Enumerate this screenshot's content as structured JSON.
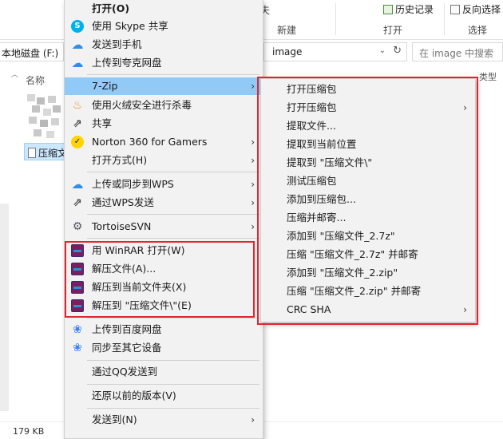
{
  "ribbon": {
    "history_label": "历史记录",
    "reverse_select_label": "反向选择",
    "new_group": "新建",
    "open_group": "打开",
    "select_group": "选择",
    "partial_left_glyph": "夫"
  },
  "address": {
    "left_text": "本地磁盘 (F:)",
    "current_folder": "image",
    "search_placeholder": "在 image 中搜索"
  },
  "filelist": {
    "column_name": "名称",
    "column_right": "类型",
    "selected_file": "压缩文"
  },
  "status": {
    "size_text": "179 KB"
  },
  "main_menu": {
    "items": [
      {
        "label": "打开(O)"
      },
      {
        "label": "使用 Skype 共享"
      },
      {
        "label": "发送到手机"
      },
      {
        "label": "上传到夸克网盘"
      },
      {
        "label": "7-Zip"
      },
      {
        "label": "使用火绒安全进行杀毒"
      },
      {
        "label": "共享"
      },
      {
        "label": "Norton 360 for Gamers"
      },
      {
        "label": "打开方式(H)"
      },
      {
        "label": "上传或同步到WPS"
      },
      {
        "label": "通过WPS发送"
      },
      {
        "label": "TortoiseSVN"
      },
      {
        "label": "用 WinRAR 打开(W)"
      },
      {
        "label": "解压文件(A)..."
      },
      {
        "label": "解压到当前文件夹(X)"
      },
      {
        "label": "解压到 \"压缩文件\\\"(E)"
      },
      {
        "label": "上传到百度网盘"
      },
      {
        "label": "同步至其它设备"
      },
      {
        "label": "通过QQ发送到"
      },
      {
        "label": "还原以前的版本(V)"
      },
      {
        "label": "发送到(N)"
      }
    ]
  },
  "sub_menu": {
    "items": [
      {
        "label": "打开压缩包"
      },
      {
        "label": "打开压缩包"
      },
      {
        "label": "提取文件..."
      },
      {
        "label": "提取到当前位置"
      },
      {
        "label": "提取到 \"压缩文件\\\""
      },
      {
        "label": "测试压缩包"
      },
      {
        "label": "添加到压缩包..."
      },
      {
        "label": "压缩并邮寄..."
      },
      {
        "label": "添加到 \"压缩文件_2.7z\""
      },
      {
        "label": "压缩 \"压缩文件_2.7z\" 并邮寄"
      },
      {
        "label": "添加到 \"压缩文件_2.zip\""
      },
      {
        "label": "压缩 \"压缩文件_2.zip\" 并邮寄"
      },
      {
        "label": "CRC SHA"
      }
    ]
  },
  "icons": {
    "arrow": "›",
    "chevron_up": "︿",
    "chevron_down": "⌄",
    "refresh": "↻",
    "skype": "S",
    "share": "⇗",
    "cloud": "☁",
    "fire": "♨",
    "norton": "✓",
    "svn": "⚙",
    "baidu": "❀"
  },
  "colors": {
    "highlight": "#91c9f7",
    "annotation_red": "#e0272d",
    "menu_bg": "#f2f2f2"
  }
}
